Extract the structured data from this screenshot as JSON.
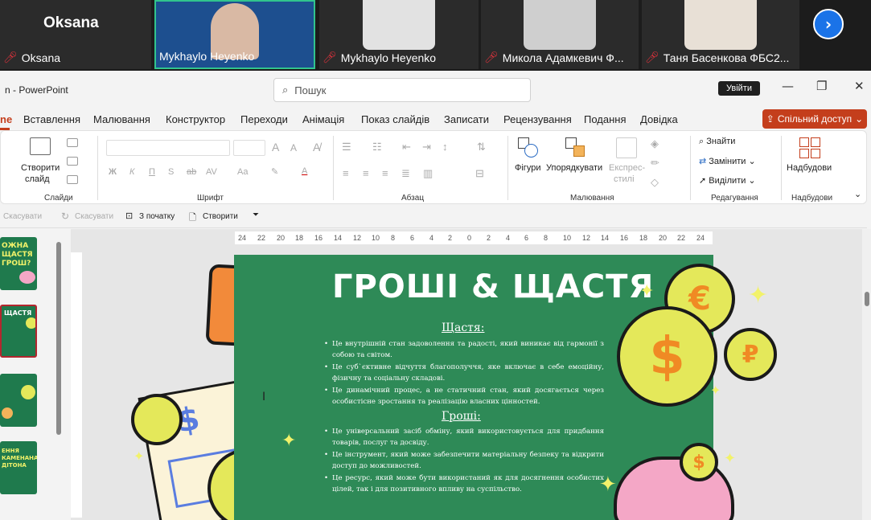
{
  "meeting": {
    "tiles": [
      {
        "name": "Oksana",
        "big_label": "Oksana",
        "muted": true
      },
      {
        "name": "Mykhaylo Heyenko",
        "muted": false,
        "active": true
      },
      {
        "name": "Mykhaylo Heyenko",
        "muted": true
      },
      {
        "name": "Микола Адамкевич Ф...",
        "muted": true
      },
      {
        "name": "Таня Басенкова ФБС2...",
        "muted": true
      }
    ],
    "next_icon": "chevron-right-icon"
  },
  "app": {
    "title": "PowerPoint",
    "search_placeholder": "Пошук",
    "tooltip": "Увійти"
  },
  "menu": {
    "home_fragment": "ne",
    "tabs": [
      "Вставлення",
      "Малювання",
      "Конструктор",
      "Переходи",
      "Анімація",
      "Показ слайдів",
      "Записати",
      "Рецензування",
      "Подання",
      "Довідка"
    ],
    "share": "Спільний доступ"
  },
  "ribbon": {
    "slides": {
      "new_slide": "Створити",
      "new_slide2": "слайд",
      "group": "Слайди"
    },
    "font": {
      "group": "Шрифт",
      "bold": "Ж",
      "italic": "К",
      "underline": "П",
      "strike": "S",
      "strike2": "ab",
      "spacing": "AV",
      "case": "Aa",
      "increase": "A",
      "decrease": "A"
    },
    "paragraph": {
      "group": "Абзац"
    },
    "drawing": {
      "shapes": "Фігури",
      "arrange": "Упорядкувати",
      "styles1": "Експрес-",
      "styles2": "стилі",
      "group": "Малювання"
    },
    "editing": {
      "find": "Знайти",
      "replace": "Замінити",
      "select": "Виділити",
      "group": "Редагування"
    },
    "addins": {
      "label": "Надбудови",
      "group": "Надбудови"
    }
  },
  "qat": {
    "undo": "Скасувати",
    "redo": "Скасувати",
    "from_start": "З початку",
    "create": "Створити"
  },
  "ruler": {
    "ticks": [
      "24",
      "22",
      "20",
      "18",
      "16",
      "14",
      "12",
      "10",
      "8",
      "6",
      "4",
      "2",
      "0",
      "2",
      "4",
      "6",
      "8",
      "10",
      "12",
      "14",
      "16",
      "18",
      "20",
      "22",
      "24"
    ]
  },
  "slide": {
    "title": "ГРОШІ & ЩАСТЯ",
    "happiness": {
      "heading": "Щастя:",
      "bullets": [
        "Це внутрішній стан задоволення та радості, який виникає від гармонії з собою та світом.",
        "Це суб`єктивне відчуття благополуччя, яке включає в себе емоційну, фізичну та соціальну складові.",
        "Це динамічний процес, а не статичний стан, який досягається через особистісне зростання та реалізацію власних цінностей."
      ]
    },
    "money": {
      "heading": "Гроші:",
      "bullets": [
        "Це універсальний засіб обміну, який використовується для придбання товарів, послуг та досвіду.",
        "Це інструмент, який може забезпечити матеріальну безпеку та відкрити доступ до можливостей.",
        "Це ресурс, який може бути використаний як для досягнення особистих цілей, так і для позитивного впливу на суспільство."
      ]
    }
  },
  "thumbnails": [
    "ОЖНА ЩАСТЯ ГРОШ?",
    "ЩАСТЯ",
    "",
    "ЕННЯ КАМЕНАНА ДІТОНА"
  ],
  "colors": {
    "accent": "#c43e1c",
    "slide_bg": "#2e8a57",
    "coin": "#e4e85a",
    "active_tile": "#31c48d"
  }
}
